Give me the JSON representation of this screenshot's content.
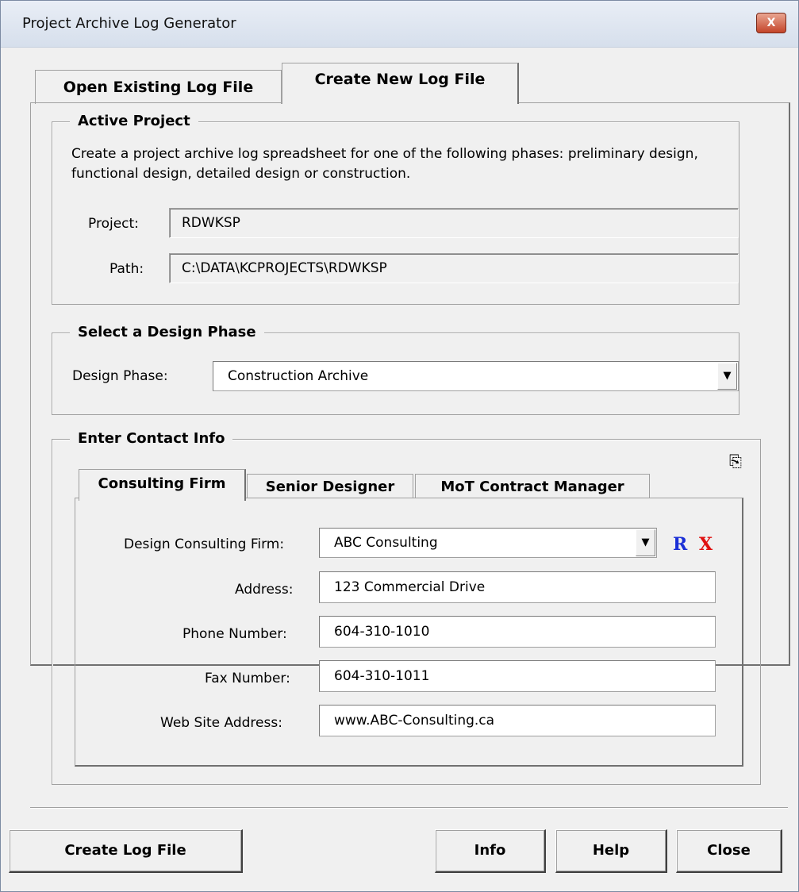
{
  "window": {
    "title": "Project Archive Log Generator",
    "close_symbol": "X"
  },
  "tabs": [
    {
      "label": "Open Existing Log File",
      "selected": false
    },
    {
      "label": "Create New Log File",
      "selected": true
    }
  ],
  "active_project": {
    "legend": "Active Project",
    "description": "Create a project archive log spreadsheet for one of the following phases: preliminary design, functional design, detailed design or construction.",
    "project_label": "Project:",
    "project_value": "RDWKSP",
    "path_label": "Path:",
    "path_value": "C:\\DATA\\KCPROJECTS\\RDWKSP"
  },
  "design_phase": {
    "legend": "Select a Design Phase",
    "label": "Design Phase:",
    "selected": "Construction Archive"
  },
  "contact": {
    "legend": "Enter Contact Info",
    "copy_icon": "copy-icon",
    "subtabs": [
      {
        "label": "Consulting Firm",
        "selected": true
      },
      {
        "label": "Senior Designer",
        "selected": false
      },
      {
        "label": "MoT Contract Manager",
        "selected": false
      }
    ],
    "firm_label": "Design Consulting Firm:",
    "firm_value": "ABC Consulting",
    "reload_symbol": "R",
    "delete_symbol": "X",
    "address_label": "Address:",
    "address_value": "123 Commercial Drive",
    "phone_label": "Phone Number:",
    "phone_value": "604-310-1010",
    "fax_label": "Fax Number:",
    "fax_value": "604-310-1011",
    "web_label": "Web Site Address:",
    "web_value": "www.ABC-Consulting.ca"
  },
  "buttons": {
    "create": "Create Log File",
    "info": "Info",
    "help": "Help",
    "close": "Close"
  },
  "colors": {
    "reload": "#1a2fd6",
    "delete": "#e01010"
  }
}
